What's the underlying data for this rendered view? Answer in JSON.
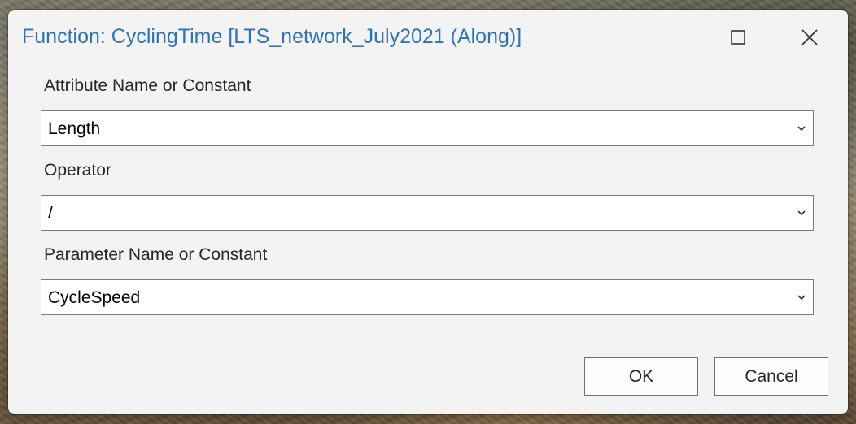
{
  "dialog": {
    "title": "Function: CyclingTime [LTS_network_July2021 (Along)]",
    "title_color": "#2e74b5",
    "maximize_icon": "maximize-icon",
    "close_icon": "close-icon"
  },
  "fields": [
    {
      "label": "Attribute Name or Constant",
      "value": "Length"
    },
    {
      "label": "Operator",
      "value": "/"
    },
    {
      "label": "Parameter Name or Constant",
      "value": "CycleSpeed"
    }
  ],
  "buttons": {
    "ok_label": "OK",
    "cancel_label": "Cancel"
  }
}
